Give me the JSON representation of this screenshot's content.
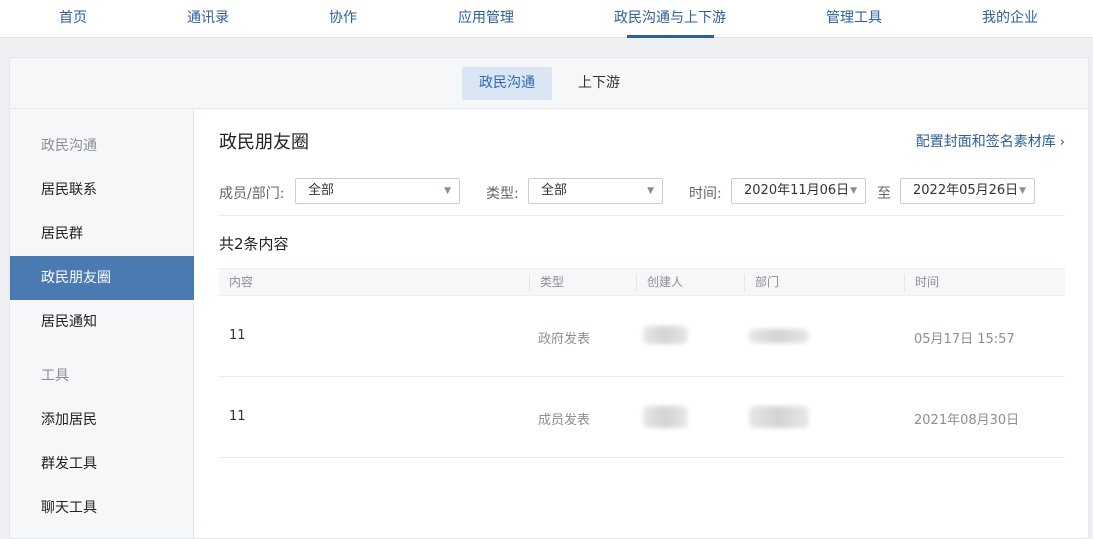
{
  "topnav": {
    "tabs": [
      {
        "label": "首页"
      },
      {
        "label": "通讯录"
      },
      {
        "label": "协作"
      },
      {
        "label": "应用管理"
      },
      {
        "label": "政民沟通与上下游"
      },
      {
        "label": "管理工具"
      },
      {
        "label": "我的企业"
      }
    ],
    "active": "政民沟通与上下游"
  },
  "subtabs": [
    {
      "label": "政民沟通",
      "active": true
    },
    {
      "label": "上下游",
      "active": false
    }
  ],
  "sidebar": {
    "items": [
      {
        "label": "政民沟通",
        "kind": "group"
      },
      {
        "label": "居民联系",
        "kind": "item"
      },
      {
        "label": "居民群",
        "kind": "item"
      },
      {
        "label": "政民朋友圈",
        "kind": "item",
        "active": true
      },
      {
        "label": "居民通知",
        "kind": "item"
      },
      {
        "label": "工具",
        "kind": "group"
      },
      {
        "label": "添加居民",
        "kind": "item"
      },
      {
        "label": "群发工具",
        "kind": "item"
      },
      {
        "label": "聊天工具",
        "kind": "item"
      }
    ]
  },
  "main": {
    "title": "政民朋友圈",
    "config_link": "配置封面和签名素材库",
    "filters": {
      "member_label": "成员/部门:",
      "member_value": "全部",
      "type_label": "类型:",
      "type_value": "全部",
      "time_label": "时间:",
      "time_start": "2020年11月06日",
      "time_to": "至",
      "time_end": "2022年05月26日"
    },
    "count_text": "共2条内容",
    "table": {
      "headers": [
        "内容",
        "类型",
        "创建人",
        "部门",
        "时间"
      ],
      "rows": [
        {
          "content": "11",
          "type": "政府发表",
          "creator": "",
          "dept": "",
          "time": "05月17日 15:57"
        },
        {
          "content": "11",
          "type": "成员发表",
          "creator": "",
          "dept": "",
          "time": "2021年08月30日"
        }
      ]
    }
  },
  "colors": {
    "accent": "#2e5f98",
    "active_sidebar": "#4a7ab1",
    "subtab_active_bg": "#dbe6f4"
  }
}
